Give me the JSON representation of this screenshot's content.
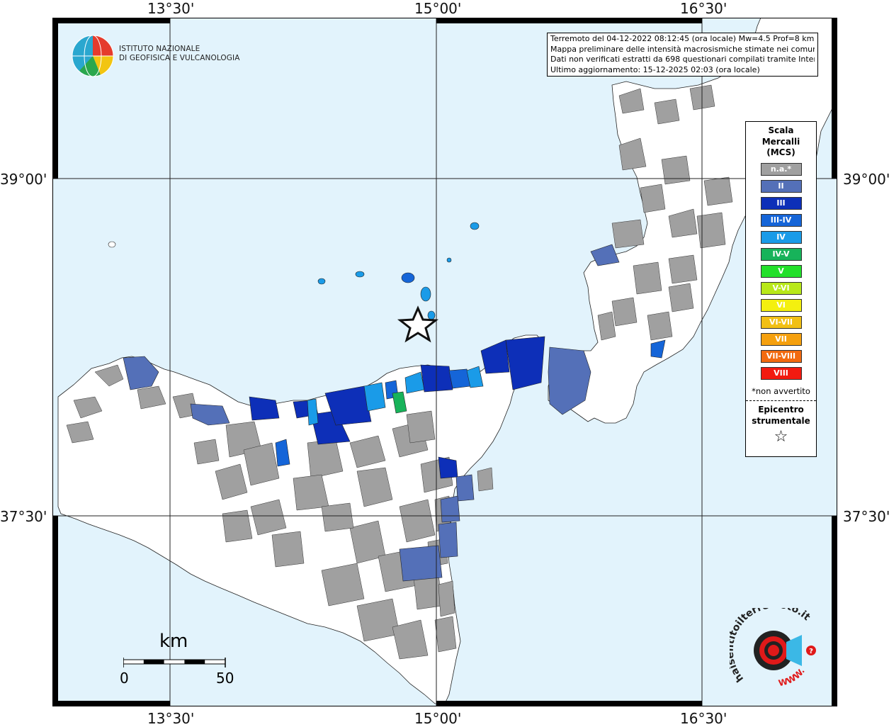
{
  "axes": {
    "lon_top": [
      "13°30'",
      "15°00'",
      "16°30'"
    ],
    "lon_bottom": [
      "13°30'",
      "15°00'",
      "16°30'"
    ],
    "lat_left": [
      "39°00'",
      "37°30'"
    ],
    "lat_right": [
      "39°00'",
      "37°30'"
    ]
  },
  "info_box": {
    "line1": "Terremoto del 04-12-2022 08:12:45 (ora locale) Mw=4.5 Prof=8 km",
    "line2": "Mappa preliminare delle intensità macrosismiche stimate nei comuni",
    "line3": "Dati non verificati estratti da 698 questionari compilati tramite Internet.",
    "line4": "Ultimo aggiornamento: 15-12-2025 02:03 (ora locale)"
  },
  "logo_ingv": {
    "line1": "ISTITUTO NAZIONALE",
    "line2": "DI GEOFISICA E VULCANOLOGIA"
  },
  "legend": {
    "title_line1": "Scala",
    "title_line2": "Mercalli",
    "title_line3": "(MCS)",
    "items": [
      {
        "label": "n.a.*",
        "color": "#a0a0a0"
      },
      {
        "label": "II",
        "color": "#5470b8"
      },
      {
        "label": "III",
        "color": "#0d2fb8"
      },
      {
        "label": "III-IV",
        "color": "#1565d8"
      },
      {
        "label": "IV",
        "color": "#1a9be8"
      },
      {
        "label": "IV-V",
        "color": "#17b35a"
      },
      {
        "label": "V",
        "color": "#22e02a"
      },
      {
        "label": "V-VI",
        "color": "#b8e81a"
      },
      {
        "label": "VI",
        "color": "#f4f00f"
      },
      {
        "label": "VI-VII",
        "color": "#f2c014"
      },
      {
        "label": "VII",
        "color": "#f5a00e"
      },
      {
        "label": "VII-VIII",
        "color": "#f26a10"
      },
      {
        "label": "VIII",
        "color": "#f21a10"
      }
    ],
    "note": "*non avvertito",
    "epicentre_line1": "Epicentro",
    "epicentre_line2": "strumentale"
  },
  "scale_bar": {
    "unit": "km",
    "start": "0",
    "end": "50"
  },
  "logo_hsit": {
    "text": "haisentitoilterremoto.it",
    "prefix": "WWW."
  },
  "colors": {
    "sea": "#e2f3fc",
    "land": "#ffffff",
    "na": "#a0a0a0"
  }
}
